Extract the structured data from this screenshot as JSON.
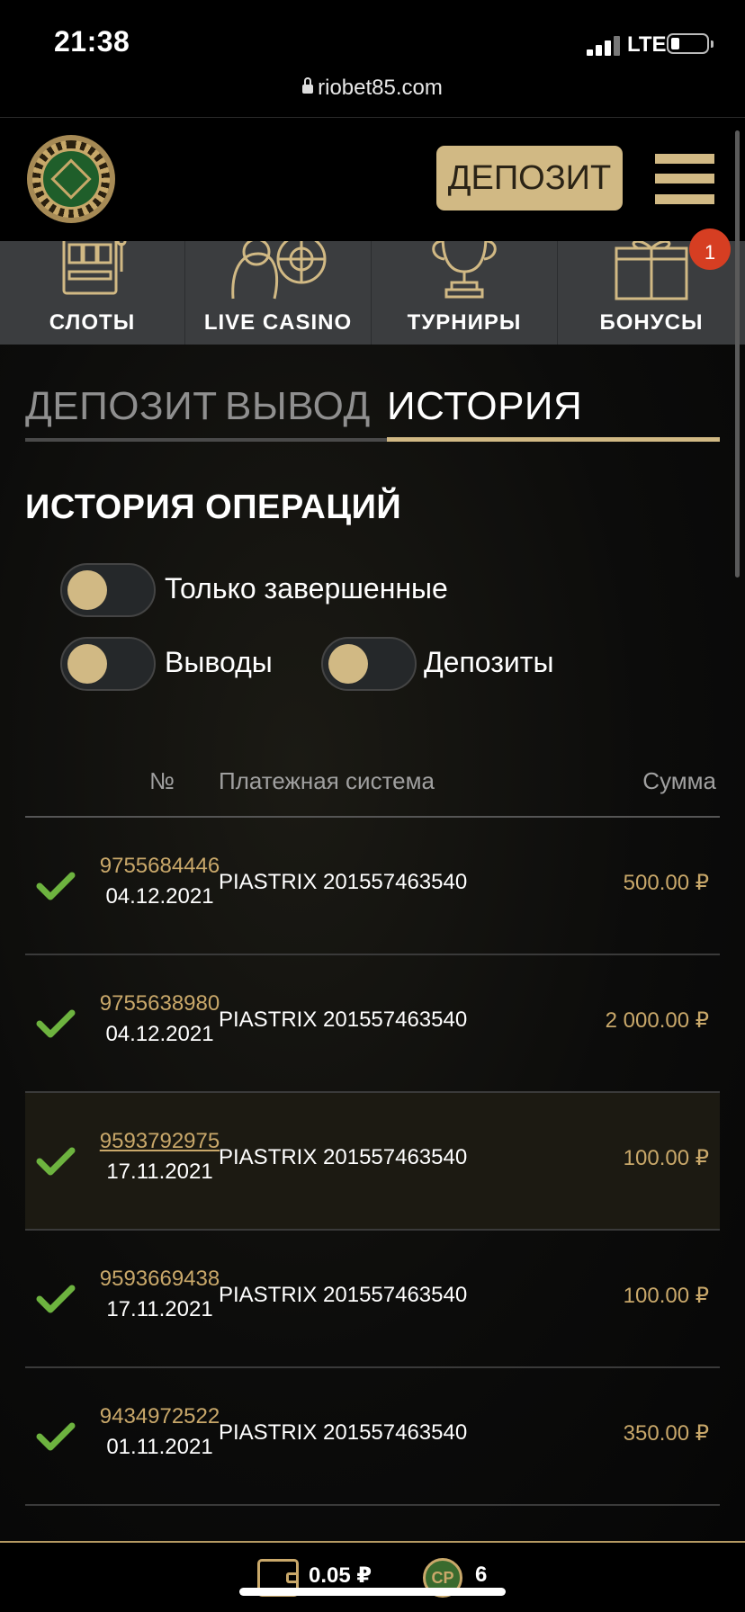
{
  "status_bar": {
    "time": "21:38",
    "network": "LTE"
  },
  "browser": {
    "url": "riobet85.com"
  },
  "header": {
    "deposit_button": "ДЕПОЗИТ"
  },
  "nav": {
    "items": [
      {
        "label": "СЛОТЫ",
        "icon": "slot-machine-icon"
      },
      {
        "label": "LIVE CASINO",
        "icon": "roulette-dealer-icon"
      },
      {
        "label": "ТУРНИРЫ",
        "icon": "trophy-icon"
      },
      {
        "label": "БОНУСЫ",
        "icon": "gift-icon"
      }
    ],
    "bonus_badge": "1"
  },
  "tabs": [
    {
      "label": "ДЕПОЗИТ",
      "active": false
    },
    {
      "label": "ВЫВОД",
      "active": false
    },
    {
      "label": "ИСТОРИЯ",
      "active": true
    }
  ],
  "history": {
    "title": "ИСТОРИЯ ОПЕРАЦИЙ",
    "filters": {
      "only_completed": "Только завершенные",
      "withdrawals": "Выводы",
      "deposits": "Депозиты"
    },
    "columns": {
      "number": "№",
      "system": "Платежная система",
      "amount": "Сумма"
    },
    "rows": [
      {
        "id": "9755684446",
        "date": "04.12.2021",
        "system": "PIASTRIX 201557463540",
        "amount": "500.00 ₽",
        "status": "completed"
      },
      {
        "id": "9755638980",
        "date": "04.12.2021",
        "system": "PIASTRIX 201557463540",
        "amount": "2 000.00 ₽",
        "status": "completed"
      },
      {
        "id": "9593792975",
        "date": "17.11.2021",
        "system": "PIASTRIX 201557463540",
        "amount": "100.00 ₽",
        "status": "completed"
      },
      {
        "id": "9593669438",
        "date": "17.11.2021",
        "system": "PIASTRIX 201557463540",
        "amount": "100.00 ₽",
        "status": "completed"
      },
      {
        "id": "9434972522",
        "date": "01.11.2021",
        "system": "PIASTRIX 201557463540",
        "amount": "350.00 ₽",
        "status": "completed"
      }
    ]
  },
  "footer": {
    "balance": "0.05 ₽",
    "cp_label": "CP",
    "cp_count": "6"
  },
  "colors": {
    "gold": "#d1b984",
    "accent_text": "#c9a86a",
    "check_green": "#6db33f",
    "badge_red": "#d63e22"
  }
}
